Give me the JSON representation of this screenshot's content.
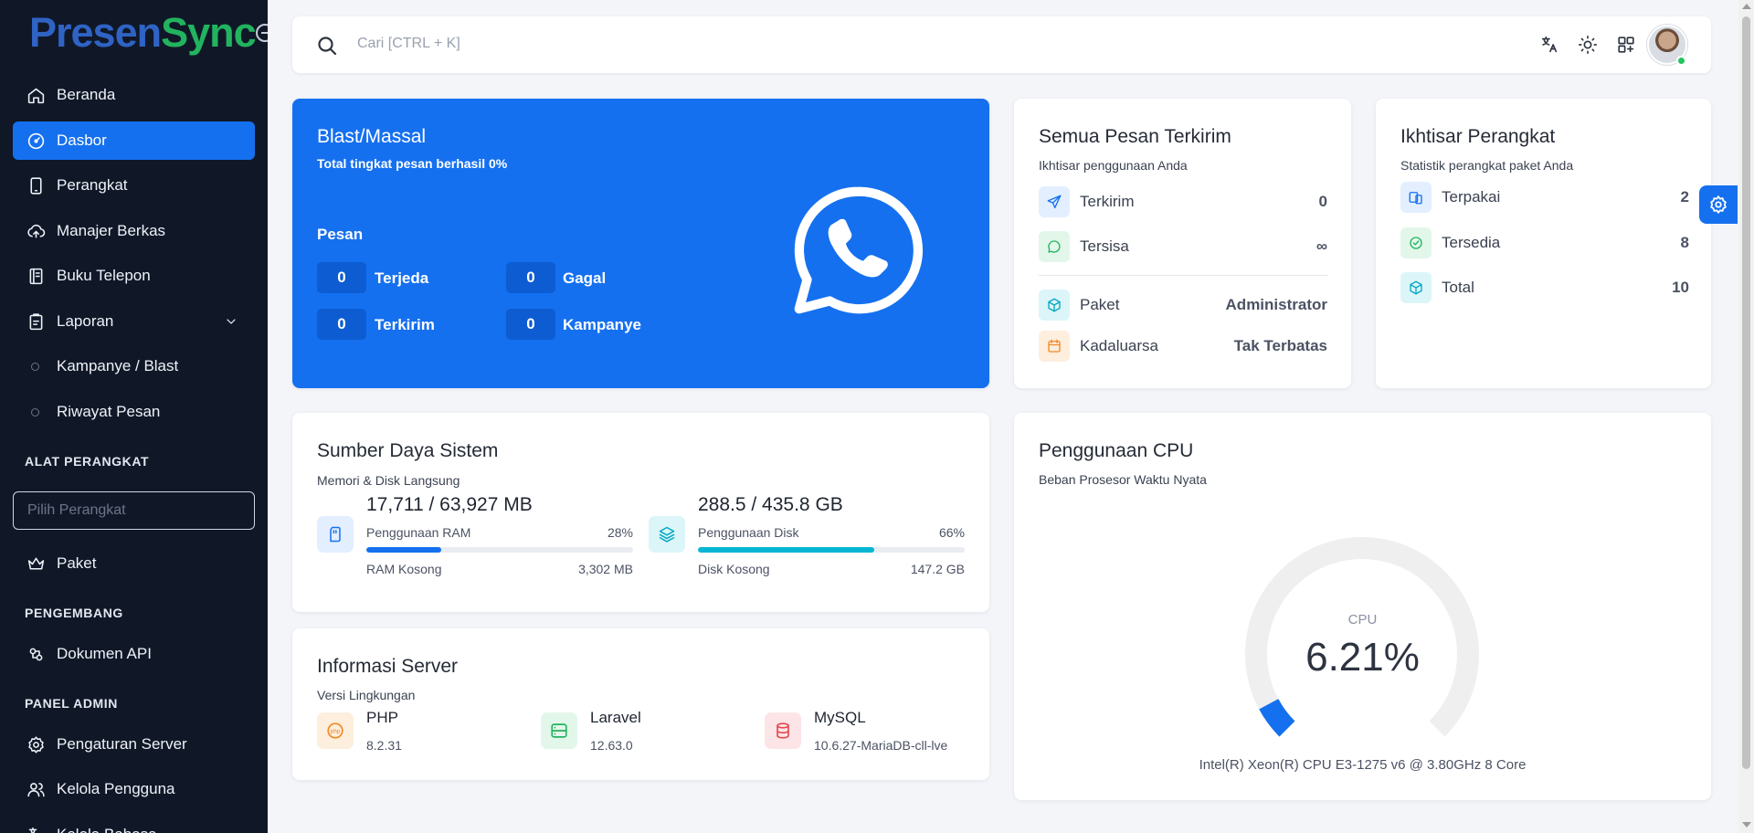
{
  "brand": {
    "part1": "Presen",
    "part2": "Sync"
  },
  "sidebar": {
    "items": [
      {
        "label": "Beranda",
        "icon": "home-icon"
      },
      {
        "label": "Dasbor",
        "icon": "gauge-icon",
        "active": true
      },
      {
        "label": "Perangkat",
        "icon": "phone-icon"
      },
      {
        "label": "Manajer Berkas",
        "icon": "cloud-upload-icon"
      },
      {
        "label": "Buku Telepon",
        "icon": "book-icon"
      },
      {
        "label": "Laporan",
        "icon": "report-icon"
      },
      {
        "label": "Kampanye / Blast",
        "icon": "circle-icon"
      },
      {
        "label": "Riwayat Pesan",
        "icon": "circle-icon"
      }
    ],
    "section_tools": "ALAT PERANGKAT",
    "device_placeholder": "Pilih Perangkat",
    "paket": "Paket",
    "section_dev": "PENGEMBANG",
    "api_docs": "Dokumen API",
    "section_admin": "PANEL ADMIN",
    "server_settings": "Pengaturan Server",
    "manage_users": "Kelola Pengguna",
    "manage_lang": "Kelola Bahasa"
  },
  "topbar": {
    "search_placeholder": "Cari [CTRL + K]"
  },
  "blast": {
    "title": "Blast/Massal",
    "subtitle": "Total tingkat pesan berhasil 0%",
    "pesan_label": "Pesan",
    "stats": [
      {
        "value": "0",
        "label": "Terjeda"
      },
      {
        "value": "0",
        "label": "Gagal"
      },
      {
        "value": "0",
        "label": "Terkirim"
      },
      {
        "value": "0",
        "label": "Kampanye"
      }
    ]
  },
  "messages": {
    "title": "Semua Pesan Terkirim",
    "subtitle": "Ikhtisar penggunaan Anda",
    "rows": [
      {
        "label": "Terkirim",
        "value": "0"
      },
      {
        "label": "Tersisa",
        "value": "∞"
      },
      {
        "label": "Paket",
        "value": "Administrator"
      },
      {
        "label": "Kadaluarsa",
        "value": "Tak Terbatas"
      }
    ]
  },
  "devices": {
    "title": "Ikhtisar Perangkat",
    "subtitle": "Statistik perangkat paket Anda",
    "rows": [
      {
        "label": "Terpakai",
        "value": "2"
      },
      {
        "label": "Tersedia",
        "value": "8"
      },
      {
        "label": "Total",
        "value": "10"
      }
    ]
  },
  "resources": {
    "title": "Sumber Daya Sistem",
    "subtitle": "Memori & Disk Langsung",
    "ram": {
      "usage": "17,711 / 63,927 MB",
      "label": "Penggunaan RAM",
      "percent_text": "28%",
      "percent": 28,
      "free_label": "RAM Kosong",
      "free_value": "3,302 MB"
    },
    "disk": {
      "usage": "288.5 / 435.8 GB",
      "label": "Penggunaan Disk",
      "percent_text": "66%",
      "percent": 66,
      "free_label": "Disk Kosong",
      "free_value": "147.2 GB"
    }
  },
  "server": {
    "title": "Informasi Server",
    "subtitle": "Versi Lingkungan",
    "items": [
      {
        "name": "PHP",
        "version": "8.2.31",
        "icon_text": "php"
      },
      {
        "name": "Laravel",
        "version": "12.63.0"
      },
      {
        "name": "MySQL",
        "version": "10.6.27-MariaDB-cll-lve"
      }
    ]
  },
  "cpu": {
    "title": "Penggunaan CPU",
    "subtitle": "Beban Prosesor Waktu Nyata",
    "label": "CPU",
    "value_text": "6.21%",
    "value": 6.21,
    "model": "Intel(R) Xeon(R) CPU E3-1275 v6 @ 3.80GHz 8 Core"
  },
  "colors": {
    "accent": "#1570ef",
    "sidebar_bg": "#101828",
    "ram_bar": "#1570ef",
    "disk_bar": "#06b6d4",
    "gauge_track": "#efefef"
  }
}
